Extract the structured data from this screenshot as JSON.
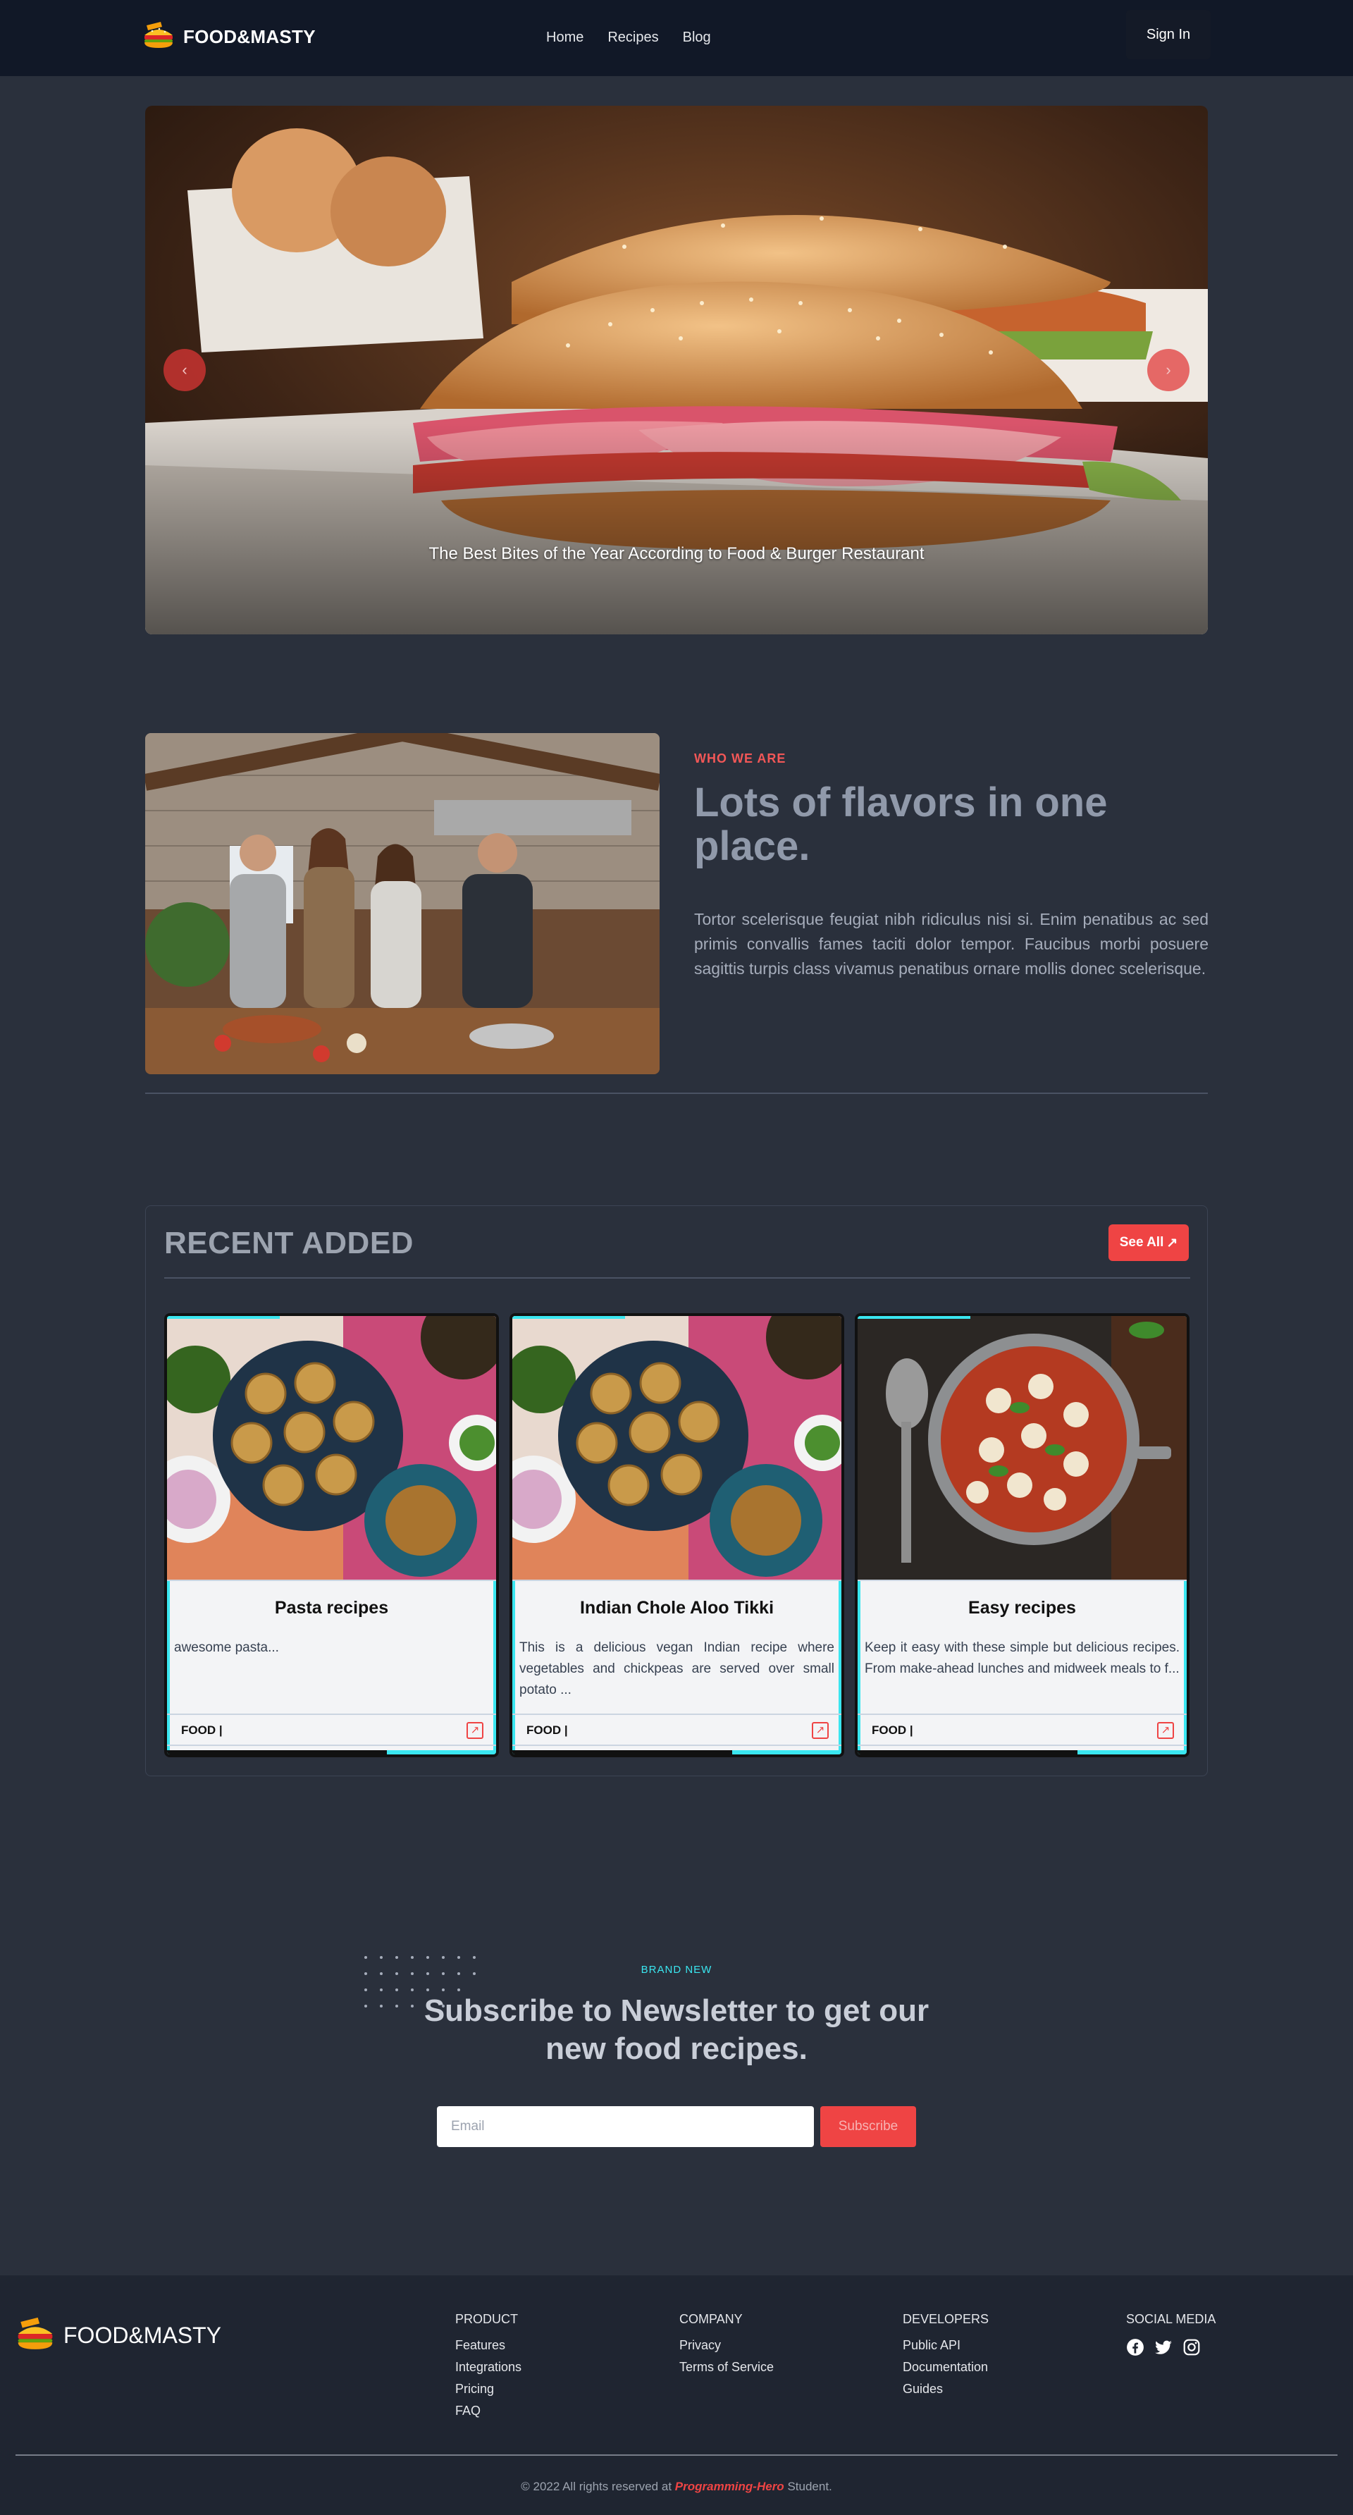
{
  "navbar": {
    "brand": "FOOD&MASTY",
    "links": [
      "Home",
      "Recipes",
      "Blog"
    ],
    "signin_label": "Sign In"
  },
  "hero": {
    "caption": "The Best Bites of the Year According to Food & Burger Restaurant",
    "prev_label": "‹",
    "next_label": "›"
  },
  "about": {
    "kicker": "WHO WE ARE",
    "title": "Lots of flavors in one place.",
    "text": "Tortor scelerisque feugiat nibh ridiculus nisi si. Enim penatibus ac sed primis convallis fames taciti dolor tempor. Faucibus morbi posuere sagittis turpis class vivamus penatibus ornare mollis donec scelerisque."
  },
  "recent": {
    "title": "RECENT ADDED",
    "see_all_label": "See All",
    "cards": [
      {
        "title": "Pasta recipes",
        "desc": "awesome pasta...",
        "tag": "FOOD |"
      },
      {
        "title": "Indian Chole Aloo Tikki",
        "desc": "This is a delicious vegan Indian recipe where vegetables and chickpeas are served over small potato ...",
        "tag": "FOOD |"
      },
      {
        "title": "Easy recipes",
        "desc": "Keep it easy with these simple but delicious recipes. From make-ahead lunches and midweek meals to f...",
        "tag": "FOOD |"
      }
    ]
  },
  "newsletter": {
    "kicker": "BRAND NEW",
    "title": "Subscribe to Newsletter to get our new food recipes.",
    "email_placeholder": "Email",
    "button_label": "Subscribe"
  },
  "footer": {
    "brand": "FOOD&MASTY",
    "columns": [
      {
        "heading": "PRODUCT",
        "links": [
          "Features",
          "Integrations",
          "Pricing",
          "FAQ"
        ]
      },
      {
        "heading": "COMPANY",
        "links": [
          "Privacy",
          "Terms of Service"
        ]
      },
      {
        "heading": "DEVELOPERS",
        "links": [
          "Public API",
          "Documentation",
          "Guides"
        ]
      },
      {
        "heading": "SOCIAL MEDIA",
        "links": []
      }
    ],
    "social_icons": [
      "facebook-icon",
      "twitter-icon",
      "instagram-icon"
    ],
    "copy_prefix": "© 2022 All rights reserved at",
    "copy_highlight": "Programming-Hero",
    "copy_suffix": "Student."
  },
  "colors": {
    "page_bg": "#2a303c",
    "navbar_bg": "#111827",
    "accent_red": "#ef4444",
    "accent_cyan": "#3ae6f0",
    "footer_bg": "#1f2531"
  }
}
